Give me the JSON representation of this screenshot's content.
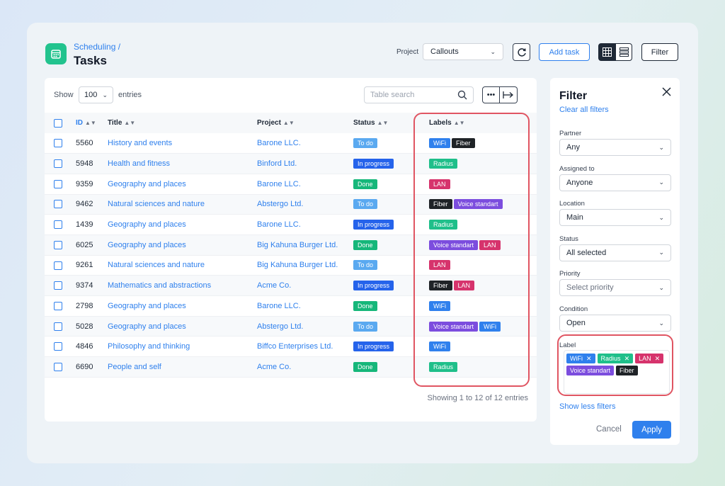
{
  "header": {
    "breadcrumb": "Scheduling /",
    "title": "Tasks",
    "project_label": "Project",
    "project_value": "Callouts",
    "add_task": "Add task",
    "filter": "Filter"
  },
  "table": {
    "show_label": "Show",
    "entries_value": "100",
    "entries_label": "entries",
    "search_placeholder": "Table search",
    "columns": {
      "id": "ID",
      "title": "Title",
      "project": "Project",
      "status": "Status",
      "labels": "Labels"
    },
    "rows": [
      {
        "id": "5560",
        "title": "History and events",
        "project": "Barone LLC.",
        "status": "To do",
        "labels": [
          "WiFi",
          "Fiber"
        ]
      },
      {
        "id": "5948",
        "title": "Health and fitness",
        "project": "Binford Ltd.",
        "status": "In progress",
        "labels": [
          "Radius"
        ]
      },
      {
        "id": "9359",
        "title": "Geography and places",
        "project": "Barone LLC.",
        "status": "Done",
        "labels": [
          "LAN"
        ]
      },
      {
        "id": "9462",
        "title": "Natural sciences and nature",
        "project": "Abstergo Ltd.",
        "status": "To do",
        "labels": [
          "Fiber",
          "Voice standart"
        ]
      },
      {
        "id": "1439",
        "title": "Geography and places",
        "project": "Barone LLC.",
        "status": "In progress",
        "labels": [
          "Radius"
        ]
      },
      {
        "id": "6025",
        "title": "Geography and places",
        "project": "Big Kahuna Burger Ltd.",
        "status": "Done",
        "labels": [
          "Voice standart",
          "LAN"
        ]
      },
      {
        "id": "9261",
        "title": "Natural sciences and nature",
        "project": "Big Kahuna Burger Ltd.",
        "status": "To do",
        "labels": [
          "LAN"
        ]
      },
      {
        "id": "9374",
        "title": "Mathematics and abstractions",
        "project": "Acme Co.",
        "status": "In progress",
        "labels": [
          "Fiber",
          "LAN"
        ]
      },
      {
        "id": "2798",
        "title": "Geography and places",
        "project": "Barone LLC.",
        "status": "Done",
        "labels": [
          "WiFi"
        ]
      },
      {
        "id": "5028",
        "title": "Geography and places",
        "project": "Abstergo Ltd.",
        "status": "To do",
        "labels": [
          "Voice standart",
          "WiFi"
        ]
      },
      {
        "id": "4846",
        "title": "Philosophy and thinking",
        "project": "Biffco Enterprises Ltd.",
        "status": "In progress",
        "labels": [
          "WiFi"
        ]
      },
      {
        "id": "6690",
        "title": "People and self",
        "project": "Acme Co.",
        "status": "Done",
        "labels": [
          "Radius"
        ]
      }
    ],
    "footer": "Showing 1 to 12 of 12 entries"
  },
  "filter": {
    "title": "Filter",
    "clear_all": "Clear all filters",
    "fields": [
      {
        "label": "Partner",
        "value": "Any"
      },
      {
        "label": "Assigned to",
        "value": "Anyone"
      },
      {
        "label": "Location",
        "value": "Main"
      },
      {
        "label": "Status",
        "value": "All selected"
      },
      {
        "label": "Priority",
        "value": "Select priority",
        "placeholder": true
      },
      {
        "label": "Condition",
        "value": "Open"
      }
    ],
    "label_field": "Label",
    "selected_labels": [
      "WiFi",
      "Radius",
      "LAN",
      "Voice standart",
      "Fiber"
    ],
    "show_less": "Show less filters",
    "cancel": "Cancel",
    "apply": "Apply"
  },
  "colors": {
    "status": {
      "To do": "#5aa9f0",
      "In progress": "#2563eb",
      "Done": "#16b77a"
    },
    "labels": {
      "WiFi": "#2f80ed",
      "Fiber": "#1f2327",
      "Radius": "#1fbf8a",
      "LAN": "#d6336c",
      "Voice standart": "#7c4dde"
    },
    "highlight": "#e05562",
    "accent": "#2f80ed"
  }
}
